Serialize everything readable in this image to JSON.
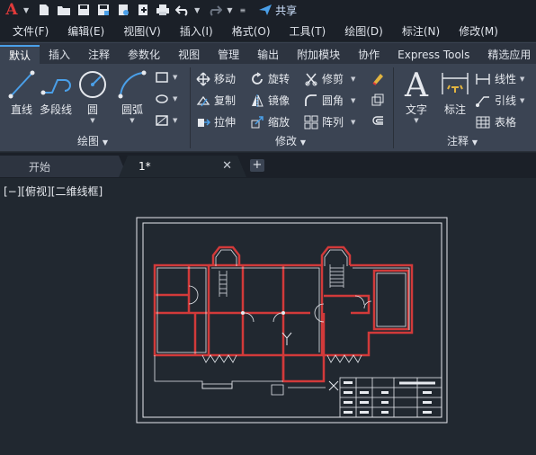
{
  "app": {
    "logo_letter": "A",
    "share_label": "共享"
  },
  "menu": [
    "文件(F)",
    "编辑(E)",
    "视图(V)",
    "插入(I)",
    "格式(O)",
    "工具(T)",
    "绘图(D)",
    "标注(N)",
    "修改(M)"
  ],
  "ribbon_tabs": [
    {
      "label": "默认",
      "active": true
    },
    {
      "label": "插入"
    },
    {
      "label": "注释"
    },
    {
      "label": "参数化"
    },
    {
      "label": "视图"
    },
    {
      "label": "管理"
    },
    {
      "label": "输出"
    },
    {
      "label": "附加模块"
    },
    {
      "label": "协作"
    },
    {
      "label": "Express Tools"
    },
    {
      "label": "精选应用"
    }
  ],
  "draw_panel": {
    "title": "绘图",
    "tools": [
      "直线",
      "多段线",
      "圆",
      "圆弧"
    ]
  },
  "modify_panel": {
    "title": "修改",
    "row1": [
      "移动",
      "旋转",
      "修剪"
    ],
    "row2": [
      "复制",
      "镜像",
      "圆角"
    ],
    "row3": [
      "拉伸",
      "缩放",
      "阵列"
    ]
  },
  "annotation_panel": {
    "title": "注释",
    "large": [
      "文字",
      "标注"
    ],
    "small": [
      "线性",
      "引线",
      "表格"
    ]
  },
  "doc_tabs": [
    {
      "label": "开始"
    },
    {
      "label": "1*",
      "active": true
    }
  ],
  "viewport_label": "[−][俯视][二维线框]",
  "colors": {
    "canvas": "#212830",
    "ribbon": "#3b4453",
    "walls": "#d23a3a",
    "linework": "#ffffff",
    "accent": "#4a9fe8"
  }
}
